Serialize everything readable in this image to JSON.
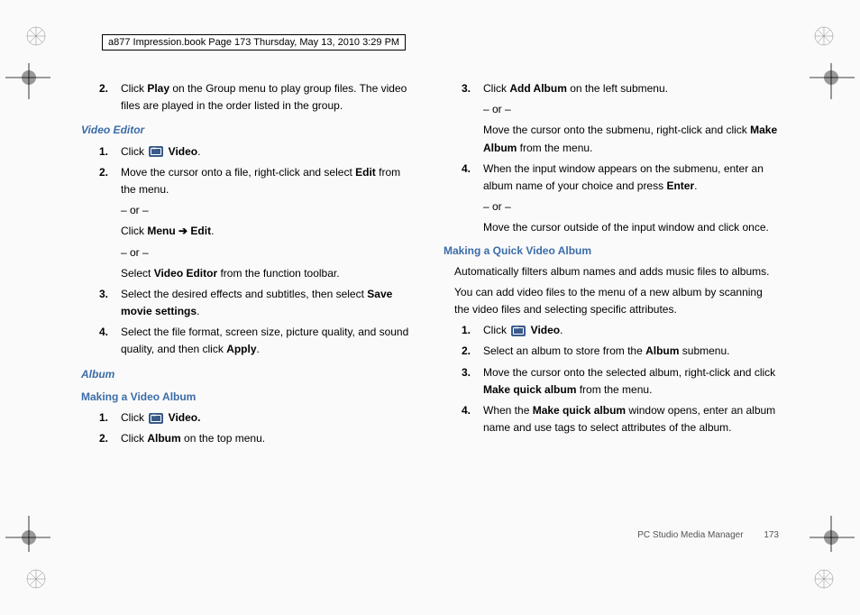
{
  "header": {
    "doc_info": "a877 Impression.book  Page 173  Thursday, May 13, 2010  3:29 PM"
  },
  "left": {
    "step2_a": "Click ",
    "step2_play": "Play",
    "step2_b": " on the Group menu to play group files. The video files are played in the order listed in the group.",
    "video_editor_h": "Video Editor",
    "ve1_a": "Click ",
    "ve1_video": " Video",
    "ve1_dot": ".",
    "ve2_a": "Move the cursor onto a file, right-click and select ",
    "ve2_edit": "Edit",
    "ve2_b": " from the menu.",
    "or1": "– or –",
    "ve2_alt1_a": "Click ",
    "ve2_alt1_menu": "Menu",
    "ve2_alt1_arrow": " ➔ ",
    "ve2_alt1_edit": "Edit",
    "ve2_alt1_dot": ".",
    "or2": "– or –",
    "ve2_alt2_a": "Select ",
    "ve2_alt2_ve": "Video Editor",
    "ve2_alt2_b": " from the function toolbar.",
    "ve3_a": "Select the desired effects and subtitles, then select ",
    "ve3_save": "Save movie settings",
    "ve3_dot": ".",
    "ve4_a": "Select the file format, screen size, picture quality, and sound quality, and then click ",
    "ve4_apply": "Apply",
    "ve4_dot": ".",
    "album_h": "Album",
    "making_video_h": "Making a Video Album",
    "mva1_a": "Click ",
    "mva1_video": " Video.",
    "mva2_a": "Click ",
    "mva2_album": "Album",
    "mva2_b": " on the top menu."
  },
  "right": {
    "r3_a": "Click ",
    "r3_add": "Add Album",
    "r3_b": " on the left submenu.",
    "r_or1": "– or –",
    "r3_alt_a": "Move the cursor onto the submenu, right-click and click ",
    "r3_alt_make": "Make Album",
    "r3_alt_b": " from the menu.",
    "r4_a": "When the input window appears on the submenu, enter an album name of your choice and press ",
    "r4_enter": "Enter",
    "r4_dot": ".",
    "r_or2": "– or –",
    "r4_alt": "Move the cursor outside of the input window and click once.",
    "quick_h": "Making a Quick Video Album",
    "quick_p1": "Automatically filters album names and adds music files to albums.",
    "quick_p2": "You can add video files to the menu of a new album by scanning the video files and selecting specific attributes.",
    "q1_a": "Click ",
    "q1_video": " Video",
    "q1_dot": ".",
    "q2_a": "Select an album to store from the ",
    "q2_album": "Album",
    "q2_b": " submenu.",
    "q3_a": "Move the cursor onto the selected album, right-click and click ",
    "q3_make": "Make quick album",
    "q3_b": " from the menu.",
    "q4_a": "When the ",
    "q4_make": "Make quick album",
    "q4_b": " window opens, enter an album name and use tags to select attributes of the album."
  },
  "footer": {
    "section": "PC Studio Media Manager",
    "page": "173"
  },
  "nums": {
    "n1": "1.",
    "n2": "2.",
    "n3": "3.",
    "n4": "4."
  }
}
